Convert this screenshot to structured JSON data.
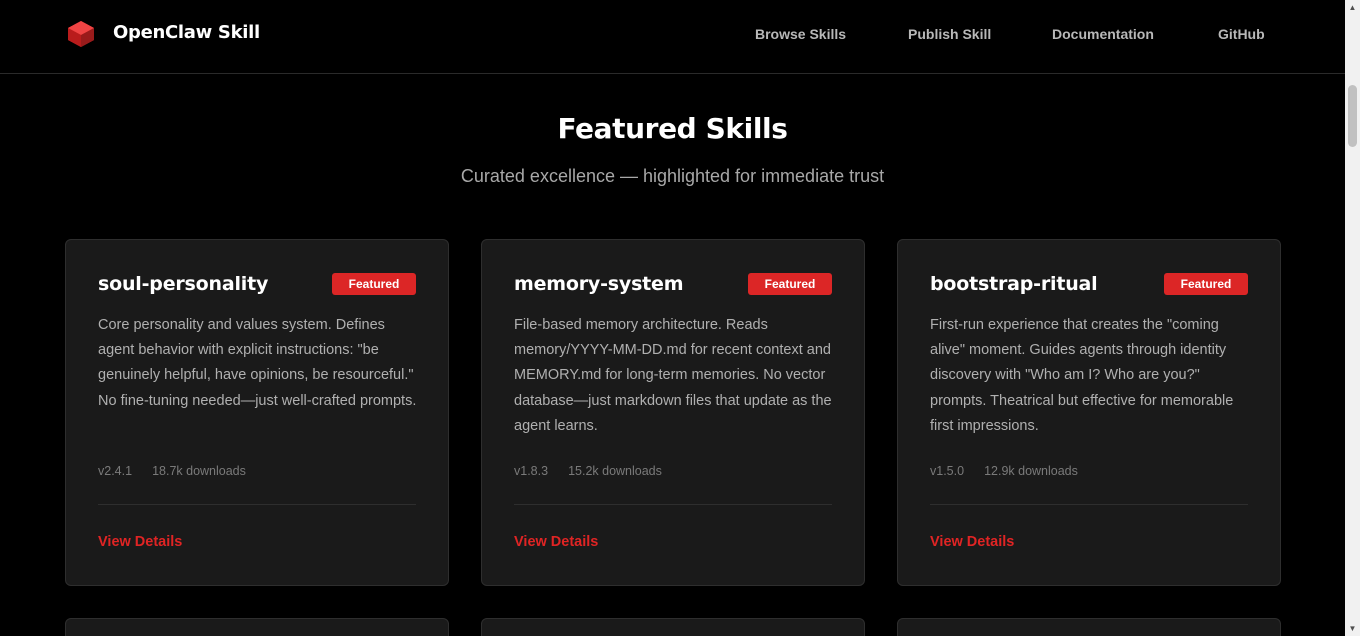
{
  "header": {
    "brand": "OpenClaw Skill",
    "logo_icon": "red-cube-logo-icon",
    "nav": [
      "Browse Skills",
      "Publish Skill",
      "Documentation",
      "GitHub"
    ]
  },
  "section": {
    "title": "Featured Skills",
    "subtitle": "Curated excellence — highlighted for immediate trust"
  },
  "cards": [
    {
      "title": "soul-personality",
      "badge": "Featured",
      "description": "Core personality and values system. Defines agent behavior with explicit instructions: \"be genuinely helpful, have opinions, be resourceful.\" No fine-tuning needed—just well-crafted prompts.",
      "version": "v2.4.1",
      "downloads": "18.7k downloads",
      "action": "View Details"
    },
    {
      "title": "memory-system",
      "badge": "Featured",
      "description": "File-based memory architecture. Reads memory/YYYY-MM-DD.md for recent context and MEMORY.md for long-term memories. No vector database—just markdown files that update as the agent learns.",
      "version": "v1.8.3",
      "downloads": "15.2k downloads",
      "action": "View Details"
    },
    {
      "title": "bootstrap-ritual",
      "badge": "Featured",
      "description": "First-run experience that creates the \"coming alive\" moment. Guides agents through identity discovery with \"Who am I? Who are you?\" prompts. Theatrical but effective for memorable first impressions.",
      "version": "v1.5.0",
      "downloads": "12.9k downloads",
      "action": "View Details"
    }
  ],
  "colors": {
    "accent": "#dc2626",
    "background": "#000000",
    "card": "#1a1a1a"
  }
}
